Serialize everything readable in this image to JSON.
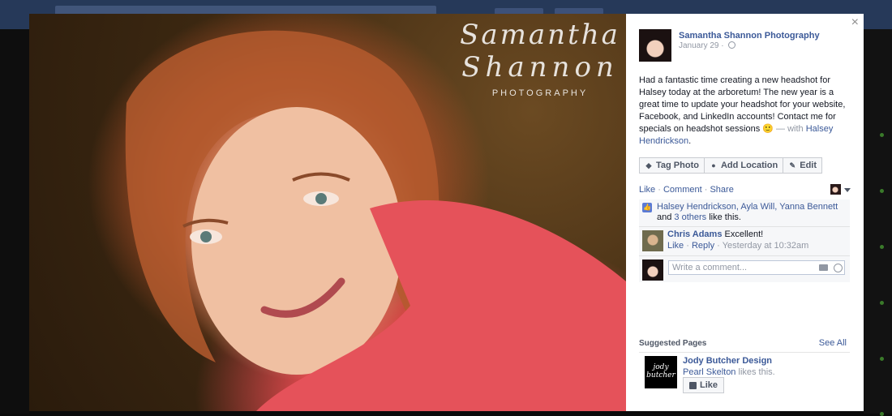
{
  "photo": {
    "watermark_line1": "Samantha",
    "watermark_line2": "Shannon",
    "watermark_line3": "PHOTOGRAPHY"
  },
  "post": {
    "page_name": "Samantha Shannon Photography",
    "date": "January 29",
    "text_main": "Had a fantastic time creating a new headshot for Halsey today at the arboretum! The new year is a great time to update your headshot for your website, Facebook, and LinkedIn accounts! Contact me for specials on headshot sessions",
    "emoji": "🙂",
    "with_prefix": " — with ",
    "tagged_person": "Halsey Hendrickson",
    "period": "."
  },
  "actions": {
    "tag_photo": "Tag Photo",
    "add_location": "Add Location",
    "edit": "Edit"
  },
  "ufi": {
    "like": "Like",
    "comment": "Comment",
    "share": "Share",
    "sep": "·",
    "likers": "Halsey Hendrickson, Ayla Will, Yanna Bennett",
    "and": " and ",
    "others": "3 others",
    "like_this": " like this."
  },
  "comment": {
    "author": "Chris Adams",
    "text": "Excellent!",
    "like": "Like",
    "reply": "Reply",
    "time": "Yesterday at 10:32am"
  },
  "write_comment": {
    "placeholder": "Write a comment..."
  },
  "suggested": {
    "title": "Suggested Pages",
    "see_all": "See All",
    "page_name": "Jody Butcher Design",
    "logo_line1": "jody",
    "logo_line2": "butcher",
    "liker": "Pearl Skelton",
    "likes_this": " likes this.",
    "like_button": "Like"
  },
  "colors": {
    "link": "#3b5998",
    "backdrop": "#0b0b0b"
  }
}
